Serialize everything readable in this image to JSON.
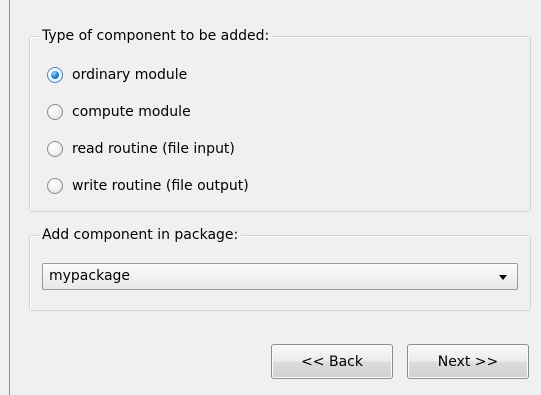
{
  "component_type_group": {
    "title": "Type of component to be added:",
    "options": [
      {
        "label": "ordinary module",
        "selected": true
      },
      {
        "label": "compute module",
        "selected": false
      },
      {
        "label": "read routine (file input)",
        "selected": false
      },
      {
        "label": "write routine (file output)",
        "selected": false
      }
    ]
  },
  "package_group": {
    "title": "Add component in package:",
    "selected_package": "mypackage"
  },
  "navigation": {
    "back_label": "<< Back",
    "next_label": "Next >>"
  }
}
